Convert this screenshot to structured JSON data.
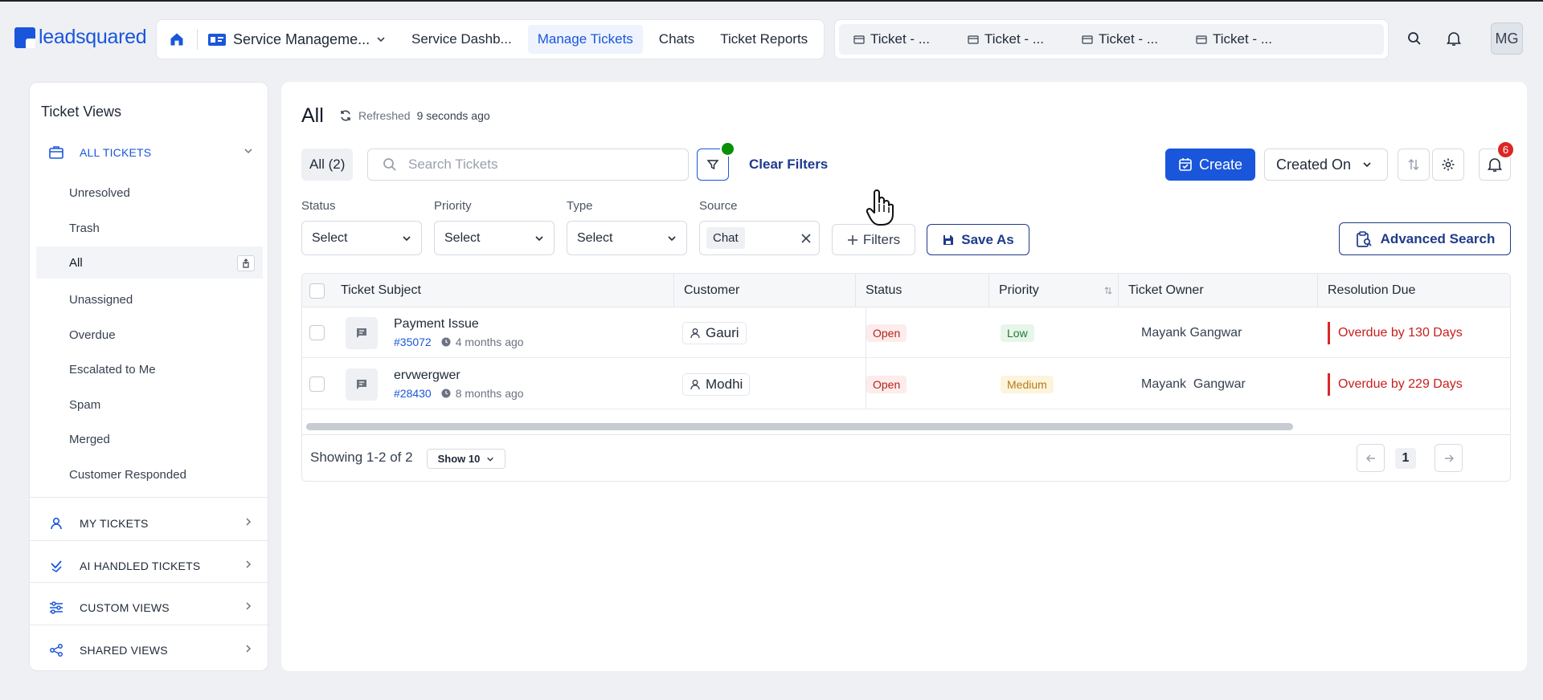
{
  "brand": {
    "name": "leadsquared",
    "color": "#1a56db"
  },
  "nav": {
    "home_icon": "home-icon",
    "app_name": "Service Manageme...",
    "tabs": [
      {
        "label": "Service Dashb...",
        "active": false
      },
      {
        "label": "Manage Tickets",
        "active": true
      },
      {
        "label": "Chats",
        "active": false
      },
      {
        "label": "Ticket Reports",
        "active": false
      }
    ],
    "recent_tabs": [
      "Ticket - ...",
      "Ticket - ...",
      "Ticket - ...",
      "Ticket - ..."
    ],
    "avatar_initials": "MG"
  },
  "sidebar": {
    "title": "Ticket Views",
    "groups": [
      {
        "label": "ALL TICKETS",
        "icon": "tickets-icon",
        "expanded": true
      },
      {
        "label": "MY TICKETS",
        "icon": "user-icon",
        "expanded": false
      },
      {
        "label": "AI HANDLED TICKETS",
        "icon": "ai-check-icon",
        "expanded": false
      },
      {
        "label": "CUSTOM VIEWS",
        "icon": "sliders-icon",
        "expanded": false
      },
      {
        "label": "SHARED VIEWS",
        "icon": "share-icon",
        "expanded": false
      }
    ],
    "items": [
      "Unresolved",
      "Trash",
      "All",
      "Unassigned",
      "Overdue",
      "Escalated to Me",
      "Spam",
      "Merged",
      "Customer Responded"
    ],
    "active_item": "All"
  },
  "main": {
    "title": "All",
    "refresh_label": "Refreshed",
    "refresh_time": "9 seconds ago",
    "count_chip": "All (2)",
    "search_placeholder": "Search Tickets",
    "clear_filters": "Clear Filters",
    "create_label": "Create",
    "sort_by": "Created On",
    "notification_count": "6",
    "filters": {
      "status": {
        "label": "Status",
        "value": "Select"
      },
      "priority": {
        "label": "Priority",
        "value": "Select"
      },
      "type": {
        "label": "Type",
        "value": "Select"
      },
      "source": {
        "label": "Source",
        "value": "Chat"
      }
    },
    "more_filters": "Filters",
    "save_as": "Save As",
    "advanced_search": "Advanced Search"
  },
  "table": {
    "columns": [
      "Ticket Subject",
      "Customer",
      "Status",
      "Priority",
      "Ticket Owner",
      "Resolution Due"
    ],
    "rows": [
      {
        "subject": "Payment Issue",
        "id": "#35072",
        "age": "4 months ago",
        "customer": "Gauri",
        "status": "Open",
        "priority": "Low",
        "owner": "Mayank Gangwar",
        "due": "Overdue by 130 Days"
      },
      {
        "subject": "ervwergwer",
        "id": "#28430",
        "age": "8 months ago",
        "customer": "Modhi",
        "status": "Open",
        "priority": "Medium",
        "owner": "Mayank  Gangwar",
        "due": "Overdue by 229 Days"
      }
    ],
    "showing": "Showing 1-2 of 2",
    "page_size": "Show 10",
    "current_page": "1"
  },
  "colors": {
    "primary": "#1a56db",
    "danger": "#dc2626",
    "success": "#0a8f08",
    "navy": "#1e3a8a"
  }
}
